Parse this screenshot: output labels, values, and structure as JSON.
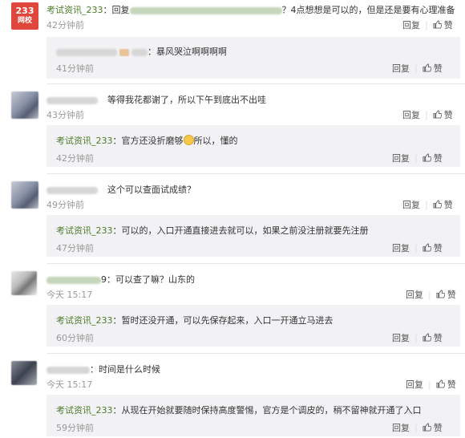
{
  "actions": {
    "reply": "回复",
    "like": "赞"
  },
  "comments": [
    {
      "avatar": {
        "l1": "233",
        "l2": "网校"
      },
      "name": "考试资讯_233",
      "text": "：回复",
      "text2": "？4点想想是可以的，但是还是要有心理准备",
      "time": "42分钟前",
      "reply": {
        "text": "：暴风哭泣啊啊啊啊",
        "time": "41分钟前"
      }
    },
    {
      "text": "等得我花都谢了，所以下午到底出不出哇",
      "time": "43分钟前",
      "reply": {
        "name": "考试资讯_233",
        "text": "：官方还没折磨够",
        "text2": "所以，懂的",
        "time": "42分钟前"
      }
    },
    {
      "text": "这个可以查面试成绩？",
      "time": "49分钟前",
      "reply": {
        "name": "考试资讯_233",
        "text": "：可以的，入口开通直接进去就可以，如果之前没注册就要先注册",
        "time": "47分钟前"
      }
    },
    {
      "text": "9：可以查了嘛？山东的",
      "time": "今天 15:17",
      "reply": {
        "name": "考试资讯_233",
        "text": "：暂时还没开通，可以先保存起来，入口一开通立马进去",
        "time": "60分钟前"
      }
    },
    {
      "text": "：时间是什么时候",
      "time": "今天 15:17",
      "reply": {
        "name": "考试资讯_233",
        "text": "：从现在开始就要随时保持高度警惕，官方是个调皮的，稍不留神就开通了入口",
        "time": "59分钟前"
      }
    }
  ]
}
